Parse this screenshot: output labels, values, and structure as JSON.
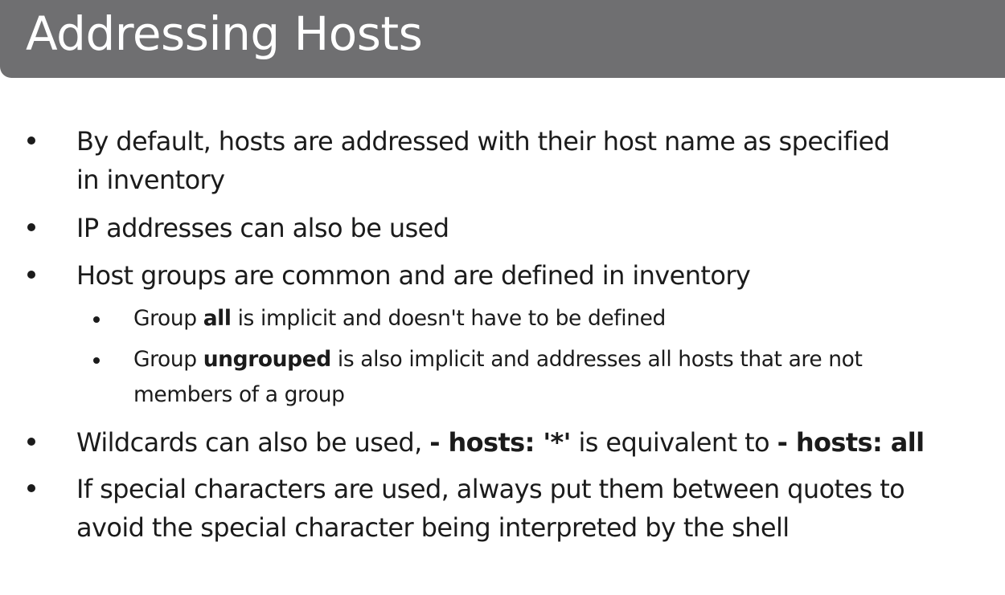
{
  "slide": {
    "title": "Addressing Hosts"
  },
  "bullets": {
    "b1": {
      "line1": "By default, hosts are addressed with their host name as specified",
      "line2": "in inventory"
    },
    "b2": {
      "text": "IP addresses can also be used"
    },
    "b3": {
      "text": "Host groups are common and are defined in inventory",
      "sub1": {
        "pre": "Group ",
        "bold": "all",
        "post": " is implicit and doesn't have to be defined"
      },
      "sub2": {
        "pre": "Group ",
        "bold": "ungrouped",
        "post": " is also implicit and addresses all hosts that are not",
        "line2": "members of a group"
      }
    },
    "b4": {
      "pre": "Wildcards can also be used, ",
      "bold1": "- hosts: '*'",
      "mid": " is equivalent to ",
      "bold2": "- hosts: all"
    },
    "b5": {
      "line1": "If special characters are used, always put them between quotes to",
      "line2": "avoid the special character being interpreted by the shell"
    }
  }
}
